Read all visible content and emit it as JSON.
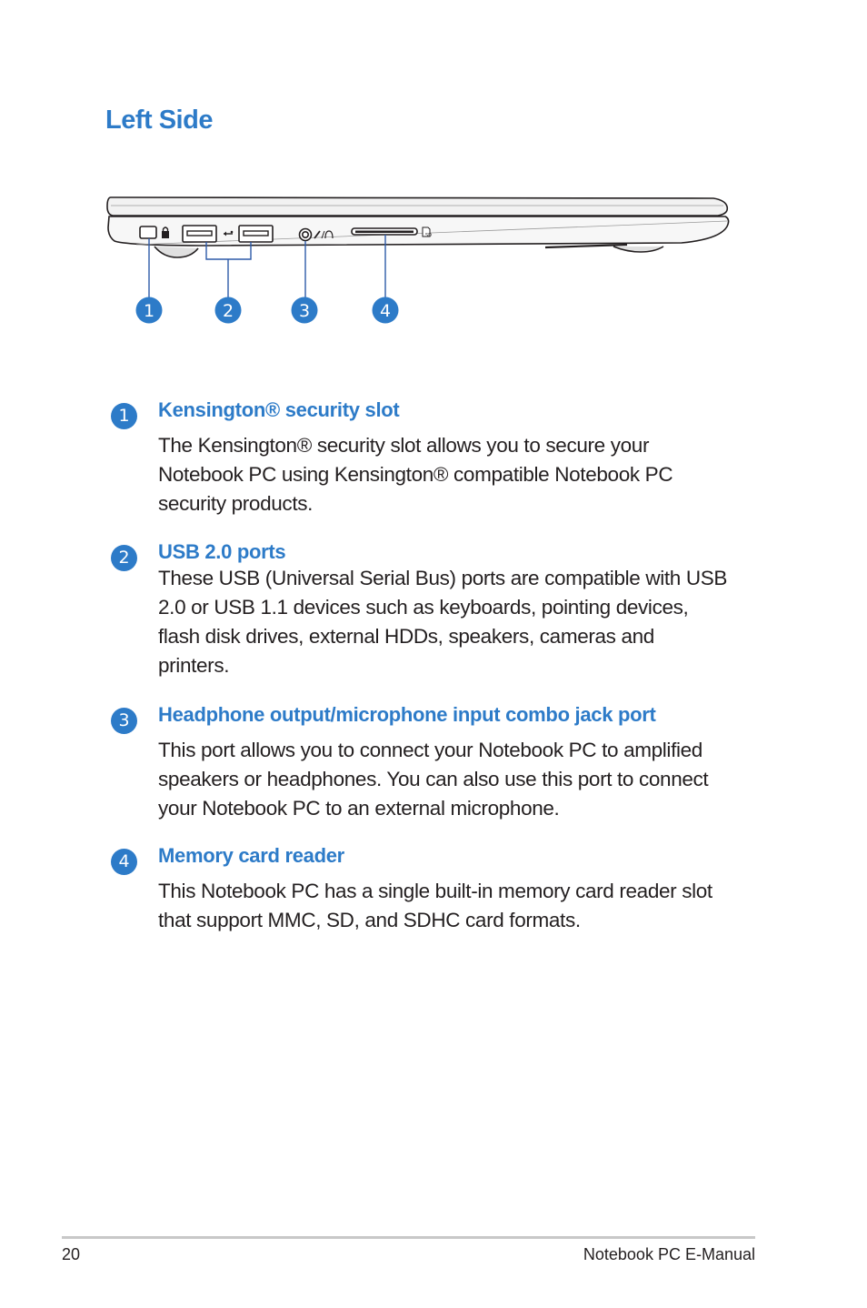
{
  "page": {
    "title": "Left Side",
    "page_number": "20",
    "footer_title": "Notebook PC E-Manual"
  },
  "figure": {
    "callouts": [
      "1",
      "2",
      "3",
      "4"
    ],
    "icons": [
      "kensington-lock-icon",
      "usb-icon",
      "headphone-mic-icon",
      "sd-card-icon"
    ],
    "sd_label": "SD",
    "accent_color": "#2d7bc8"
  },
  "items": [
    {
      "number": "1",
      "heading": "Kensington® security slot",
      "body_lines": [
        "The Kensington® security slot allows you to secure your",
        "Notebook PC using Kensington® compatible Notebook PC",
        "security products."
      ]
    },
    {
      "number": "2",
      "heading": "USB 2.0 ports",
      "body_lines": [
        "These USB (Universal Serial Bus) ports are compatible with USB",
        "2.0 or USB 1.1 devices such as keyboards, pointing devices,",
        "flash disk drives, external HDDs, speakers, cameras and",
        "printers."
      ]
    },
    {
      "number": "3",
      "heading": "Headphone output/microphone input combo jack port",
      "body_lines": [
        "This port allows you to connect your Notebook PC to amplified",
        "speakers or headphones. You can also use this port to connect",
        "your Notebook PC to an external microphone."
      ]
    },
    {
      "number": "4",
      "heading": "Memory card reader",
      "body_lines": [
        "This Notebook PC has a single built-in memory card reader slot",
        "that support MMC, SD, and SDHC card formats."
      ]
    }
  ]
}
